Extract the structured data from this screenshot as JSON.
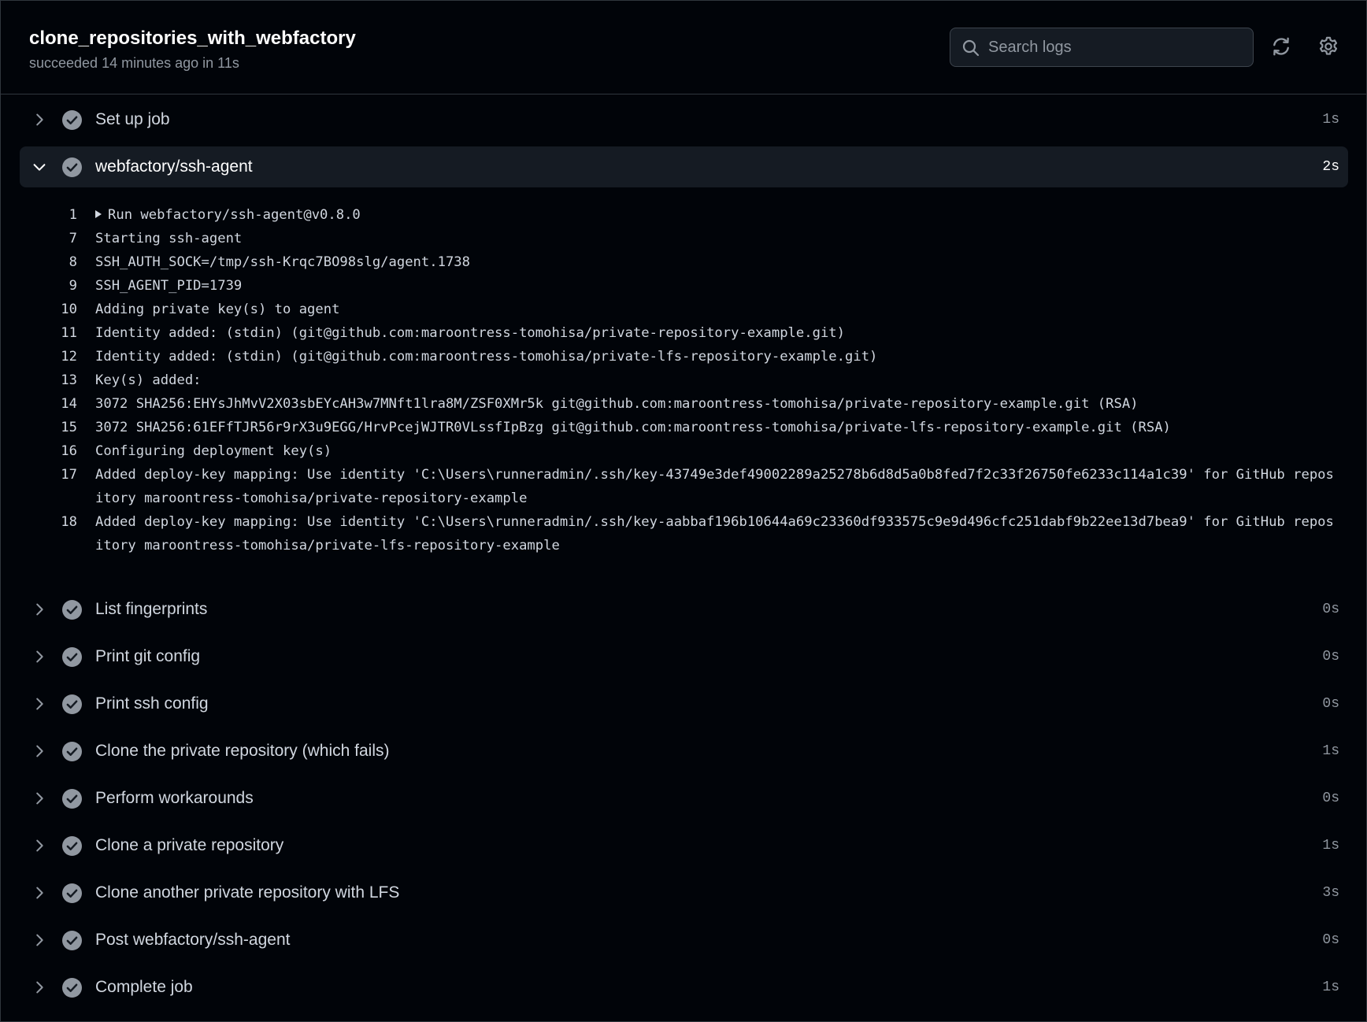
{
  "job": {
    "title": "clone_repositories_with_webfactory",
    "status": "succeeded 14 minutes ago in 11s"
  },
  "search": {
    "placeholder": "Search logs",
    "icon": "search-icon"
  },
  "toolbar": {
    "refresh_icon": "refresh-icon",
    "settings_icon": "gear-icon"
  },
  "colors": {
    "background": "#010409",
    "expanded_row": "#151b23",
    "success_check": "#9198a1"
  },
  "steps": [
    {
      "name": "Set up job",
      "duration": "1s",
      "expanded": false
    },
    {
      "name": "webfactory/ssh-agent",
      "duration": "2s",
      "expanded": true
    },
    {
      "name": "List fingerprints",
      "duration": "0s",
      "expanded": false
    },
    {
      "name": "Print git config",
      "duration": "0s",
      "expanded": false
    },
    {
      "name": "Print ssh config",
      "duration": "0s",
      "expanded": false
    },
    {
      "name": "Clone the private repository (which fails)",
      "duration": "1s",
      "expanded": false
    },
    {
      "name": "Perform workarounds",
      "duration": "0s",
      "expanded": false
    },
    {
      "name": "Clone a private repository",
      "duration": "1s",
      "expanded": false
    },
    {
      "name": "Clone another private repository with LFS",
      "duration": "3s",
      "expanded": false
    },
    {
      "name": "Post webfactory/ssh-agent",
      "duration": "0s",
      "expanded": false
    },
    {
      "name": "Complete job",
      "duration": "1s",
      "expanded": false
    }
  ],
  "log_lines": [
    {
      "n": "1",
      "text": "Run webfactory/ssh-agent@v0.8.0",
      "group": true
    },
    {
      "n": "7",
      "text": "Starting ssh-agent"
    },
    {
      "n": "8",
      "text": "SSH_AUTH_SOCK=/tmp/ssh-Krqc7BO98slg/agent.1738"
    },
    {
      "n": "9",
      "text": "SSH_AGENT_PID=1739"
    },
    {
      "n": "10",
      "text": "Adding private key(s) to agent"
    },
    {
      "n": "11",
      "text": "Identity added: (stdin) (git@github.com:maroontress-tomohisa/private-repository-example.git)"
    },
    {
      "n": "12",
      "text": "Identity added: (stdin) (git@github.com:maroontress-tomohisa/private-lfs-repository-example.git)"
    },
    {
      "n": "13",
      "text": "Key(s) added:"
    },
    {
      "n": "14",
      "text": "3072 SHA256:EHYsJhMvV2X03sbEYcAH3w7MNft1lra8M/ZSF0XMr5k git@github.com:maroontress-tomohisa/private-repository-example.git (RSA)"
    },
    {
      "n": "15",
      "text": "3072 SHA256:61EFfTJR56r9rX3u9EGG/HrvPcejWJTR0VLssfIpBzg git@github.com:maroontress-tomohisa/private-lfs-repository-example.git (RSA)"
    },
    {
      "n": "16",
      "text": "Configuring deployment key(s)"
    },
    {
      "n": "17",
      "text": "Added deploy-key mapping: Use identity 'C:\\Users\\runneradmin/.ssh/key-43749e3def49002289a25278b6d8d5a0b8fed7f2c33f26750fe6233c114a1c39' for GitHub repository maroontress-tomohisa/private-repository-example"
    },
    {
      "n": "18",
      "text": "Added deploy-key mapping: Use identity 'C:\\Users\\runneradmin/.ssh/key-aabbaf196b10644a69c23360df933575c9e9d496cfc251dabf9b22ee13d7bea9' for GitHub repository maroontress-tomohisa/private-lfs-repository-example"
    }
  ]
}
